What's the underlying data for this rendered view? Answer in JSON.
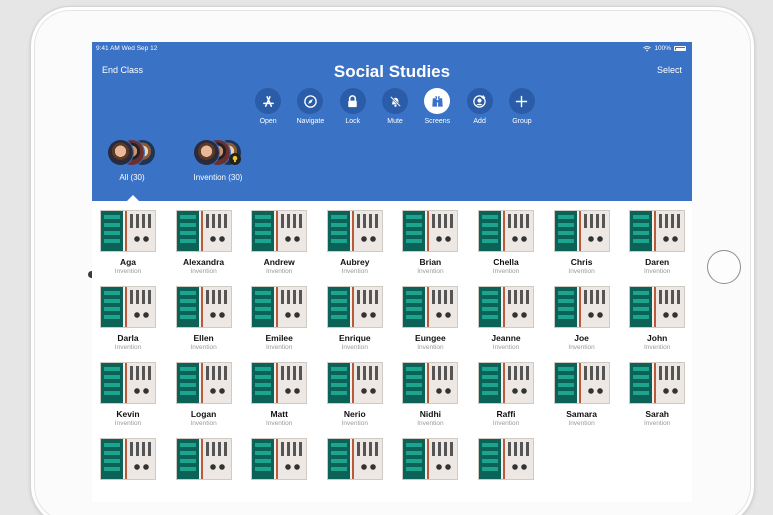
{
  "status_bar": {
    "time": "9:41 AM  Wed Sep 12",
    "battery": "100%"
  },
  "header": {
    "title": "Social Studies",
    "left_button": "End Class",
    "right_button": "Select"
  },
  "toolbar": [
    {
      "label": "Open",
      "icon": "app-store-icon",
      "active": false
    },
    {
      "label": "Navigate",
      "icon": "compass-icon",
      "active": false
    },
    {
      "label": "Lock",
      "icon": "lock-icon",
      "active": false
    },
    {
      "label": "Mute",
      "icon": "bell-mute-icon",
      "active": false
    },
    {
      "label": "Screens",
      "icon": "binoculars-icon",
      "active": true
    },
    {
      "label": "Add",
      "icon": "add-person-icon",
      "active": false
    },
    {
      "label": "Group",
      "icon": "plus-icon",
      "active": false
    }
  ],
  "groups": [
    {
      "label": "All (30)",
      "selected": true
    },
    {
      "label": "Invention (30)",
      "selected": false
    }
  ],
  "students": [
    {
      "name": "Aga",
      "group": "Invention"
    },
    {
      "name": "Alexandra",
      "group": "Invention"
    },
    {
      "name": "Andrew",
      "group": "Invention"
    },
    {
      "name": "Aubrey",
      "group": "Invention"
    },
    {
      "name": "Brian",
      "group": "Invention"
    },
    {
      "name": "Chella",
      "group": "Invention"
    },
    {
      "name": "Chris",
      "group": "Invention"
    },
    {
      "name": "Daren",
      "group": "Invention"
    },
    {
      "name": "Darla",
      "group": "Invention"
    },
    {
      "name": "Ellen",
      "group": "Invention"
    },
    {
      "name": "Emilee",
      "group": "Invention"
    },
    {
      "name": "Enrique",
      "group": "Invention"
    },
    {
      "name": "Eungee",
      "group": "Invention"
    },
    {
      "name": "Jeanne",
      "group": "Invention"
    },
    {
      "name": "Joe",
      "group": "Invention"
    },
    {
      "name": "John",
      "group": "Invention"
    },
    {
      "name": "Kevin",
      "group": "Invention"
    },
    {
      "name": "Logan",
      "group": "Invention"
    },
    {
      "name": "Matt",
      "group": "Invention"
    },
    {
      "name": "Nerio",
      "group": "Invention"
    },
    {
      "name": "Nidhi",
      "group": "Invention"
    },
    {
      "name": "Raffi",
      "group": "Invention"
    },
    {
      "name": "Samara",
      "group": "Invention"
    },
    {
      "name": "Sarah",
      "group": "Invention"
    },
    {
      "name": "",
      "group": ""
    },
    {
      "name": "",
      "group": ""
    },
    {
      "name": "",
      "group": ""
    },
    {
      "name": "",
      "group": ""
    },
    {
      "name": "",
      "group": ""
    },
    {
      "name": "",
      "group": ""
    }
  ],
  "colors": {
    "header_bg": "#3a72c6",
    "tool_circle": "#2b5ca8",
    "screen_dark": "#0c6257",
    "screen_accent": "#1da48f"
  }
}
